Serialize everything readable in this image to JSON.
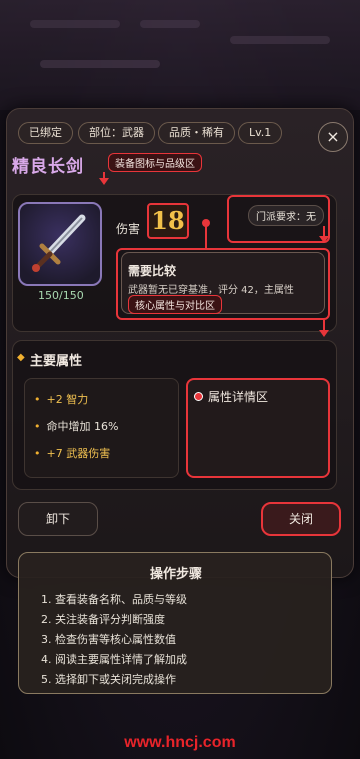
{
  "header": {
    "chips": [
      "已绑定",
      "部位：武器",
      "品质・稀有",
      "Lv.1"
    ],
    "close_icon": "×"
  },
  "item": {
    "name": "精良长剑",
    "durability": "150/150",
    "damage_label": "伤害",
    "damage_value": "18",
    "sect_requirement": "门派要求：无"
  },
  "compare": {
    "title": "需要比较",
    "text": "武器暂无已穿基准，评分 42，主属性"
  },
  "attributes": {
    "heading": "主要属性",
    "items": [
      "+2 智力",
      "命中增加 16%",
      "+7 武器伤害"
    ],
    "detail_label": "属性详情区"
  },
  "annotations": {
    "icon_area": "装备图标与品级区",
    "core_area": "核心属性与对比区"
  },
  "buttons": {
    "unequip": "卸下",
    "close": "关闭"
  },
  "steps": {
    "title": "操作步骤",
    "items": [
      "1. 查看装备名称、品质与等级",
      "2. 关注装备评分判断强度",
      "3. 检查伤害等核心属性数值",
      "4. 阅读主要属性详情了解加成",
      "5. 选择卸下或关闭完成操作"
    ]
  },
  "watermark": "www.hncj.com",
  "colors": {
    "accent_red": "#e8353a",
    "gold": "#f0b030",
    "title_purple": "#d8a8e8"
  }
}
